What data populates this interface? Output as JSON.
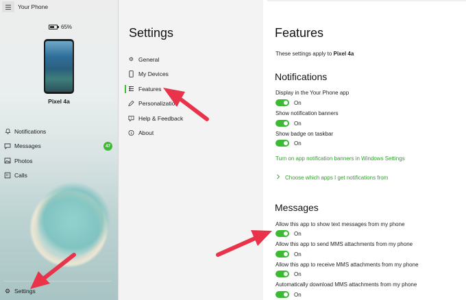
{
  "app": {
    "title": "Your Phone",
    "battery_percent": "65%",
    "phone_name": "Pixel 4a"
  },
  "sidebar": {
    "items": [
      {
        "label": "Notifications",
        "icon": "bell-icon"
      },
      {
        "label": "Messages",
        "icon": "message-icon",
        "badge": "47"
      },
      {
        "label": "Photos",
        "icon": "photos-icon"
      },
      {
        "label": "Calls",
        "icon": "calls-icon"
      }
    ],
    "settings_label": "Settings"
  },
  "settings_nav": {
    "title": "Settings",
    "items": [
      {
        "label": "General",
        "icon": "gear-icon"
      },
      {
        "label": "My Devices",
        "icon": "device-icon"
      },
      {
        "label": "Features",
        "icon": "features-icon",
        "active": true
      },
      {
        "label": "Personalization",
        "icon": "personalization-icon"
      },
      {
        "label": "Help & Feedback",
        "icon": "help-icon"
      },
      {
        "label": "About",
        "icon": "info-icon"
      }
    ]
  },
  "features": {
    "title": "Features",
    "subtitle_prefix": "These settings apply to ",
    "subtitle_device": "Pixel 4a",
    "notifications_heading": "Notifications",
    "notification_settings": [
      {
        "label": "Display in the Your Phone app",
        "state": "On"
      },
      {
        "label": "Show notification banners",
        "state": "On"
      },
      {
        "label": "Show badge on taskbar",
        "state": "On"
      }
    ],
    "link_windows_settings": "Turn on app notification banners in Windows Settings",
    "link_choose_apps": "Choose which apps I get notifications from",
    "messages_heading": "Messages",
    "message_settings": [
      {
        "label": "Allow this app to show text messages from my phone",
        "state": "On"
      },
      {
        "label": "Allow this app to send MMS attachments from my phone",
        "state": "On"
      },
      {
        "label": "Allow this app to receive MMS attachments from my phone",
        "state": "On"
      },
      {
        "label": "Automatically download MMS attachments from my phone",
        "state": "On"
      }
    ]
  },
  "colors": {
    "accent": "#3dba34",
    "link": "#2e9e2a",
    "annotation_arrow": "#e8334a"
  }
}
